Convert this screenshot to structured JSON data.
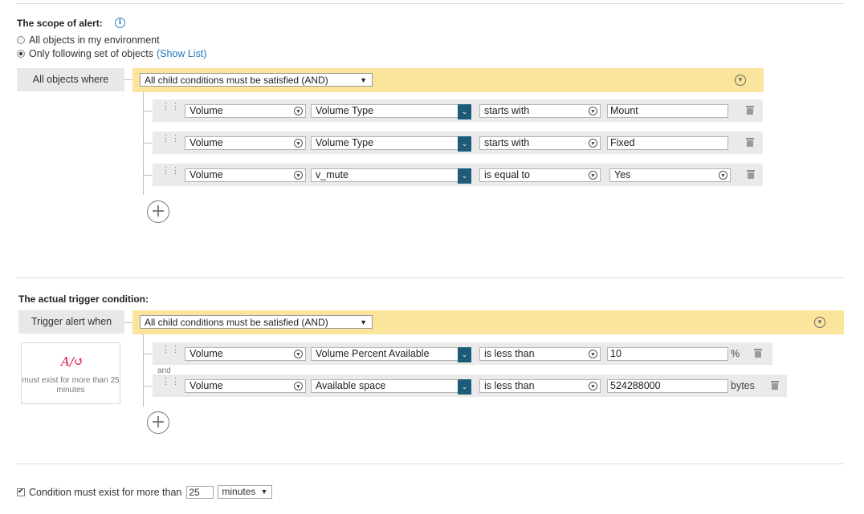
{
  "scope": {
    "title": "The scope of alert:",
    "option_all": "All objects in my environment",
    "option_following": "Only following set of objects",
    "show_list": "(Show List)",
    "label": "All objects where",
    "group_condition": "All child conditions must be satisfied (AND)",
    "conditions": [
      {
        "object": "Volume",
        "field": "Volume Type",
        "operator": "starts with",
        "value": "Mount"
      },
      {
        "object": "Volume",
        "field": "Volume Type",
        "operator": "starts with",
        "value": "Fixed"
      },
      {
        "object": "Volume",
        "field": "v_mute",
        "operator": "is equal to",
        "value": "Yes"
      }
    ]
  },
  "trigger": {
    "title": "The actual trigger condition:",
    "label": "Trigger alert when",
    "group_condition": "All child conditions must be satisfied (AND)",
    "duration_note": "must exist for more than 25 minutes",
    "and_label": "and",
    "conditions": [
      {
        "object": "Volume",
        "field": "Volume Percent Available",
        "operator": "is less than",
        "value": "10",
        "unit": "%"
      },
      {
        "object": "Volume",
        "field": "Available space",
        "operator": "is less than",
        "value": "524288000",
        "unit": "bytes"
      }
    ]
  },
  "footer": {
    "label": "Condition must exist for more than",
    "value": "25",
    "unit": "minutes"
  },
  "icons": {
    "info": "info-icon",
    "drag": "drag-handle-icon",
    "trash": "trash-icon",
    "add": "plus-icon",
    "collapse": "chevron-down-icon"
  },
  "colors": {
    "group_bar": "#fbe49c",
    "field_dropdown": "#1d5c78",
    "link": "#1f74b7"
  }
}
